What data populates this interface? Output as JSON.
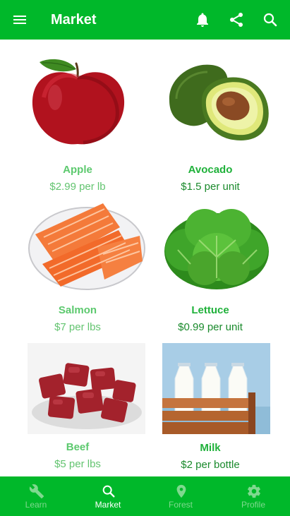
{
  "app_bar": {
    "title": "Market",
    "icons": [
      "menu-icon",
      "bell-icon",
      "share-icon",
      "search-icon"
    ]
  },
  "products": [
    {
      "name": "Apple",
      "price": "$2.99 per lb"
    },
    {
      "name": "Avocado",
      "price": "$1.5 per unit"
    },
    {
      "name": "Salmon",
      "price": "$7 per lbs"
    },
    {
      "name": "Lettuce",
      "price": "$0.99 per unit"
    },
    {
      "name": "Beef",
      "price": "$5 per lbs"
    },
    {
      "name": "Milk",
      "price": "$2 per bottle"
    }
  ],
  "bottom_nav": {
    "tabs": [
      {
        "label": "Learn",
        "icon": "wrench-icon"
      },
      {
        "label": "Market",
        "icon": "search-icon"
      },
      {
        "label": "Forest",
        "icon": "location-pin-icon"
      },
      {
        "label": "Profile",
        "icon": "gear-icon"
      }
    ],
    "active": "Market"
  },
  "colors": {
    "primary": "#00b82a",
    "name_light": "#5cc96e",
    "name_dark": "#1fb13a",
    "price_light": "#63c470",
    "price_dark": "#1a8a2c",
    "tab_active": "#ffffff",
    "tab_inactive": "#7fd98f"
  }
}
